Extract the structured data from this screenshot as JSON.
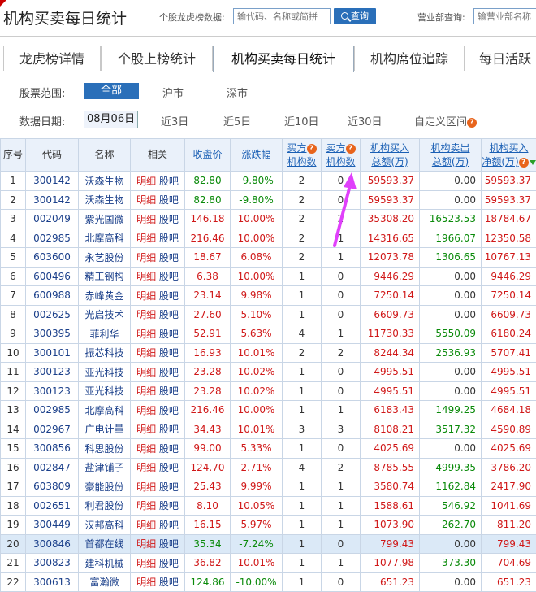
{
  "header": {
    "title": "机构买卖每日统计",
    "stock_search_label": "个股龙虎榜数据:",
    "stock_search_placeholder": "输代码、名称或简拼",
    "search_button": "查询",
    "branch_search_label": "营业部查询:",
    "branch_search_placeholder": "输营业部名称"
  },
  "tabs": [
    "龙虎榜详情",
    "个股上榜统计",
    "机构买卖每日统计",
    "机构席位追踪",
    "每日活跃"
  ],
  "active_tab": 2,
  "filters": {
    "range_label": "股票范围:",
    "range_options": [
      "全部",
      "沪市",
      "深市"
    ],
    "range_selected": "全部",
    "date_label": "数据日期:",
    "date_selected": "08月06日",
    "date_options": [
      "近3日",
      "近5日",
      "近10日",
      "近30日",
      "自定义区间"
    ]
  },
  "table": {
    "columns": [
      "序号",
      "代码",
      "名称",
      "相关",
      "收盘价",
      "涨跌幅",
      "买方机构数",
      "卖方机构数",
      "机构买入总额(万)",
      "机构卖出总额(万)",
      "机构买入净额(万)"
    ],
    "header_lines": {
      "buyers": [
        "买方",
        "机构数"
      ],
      "sellers": [
        "卖方",
        "机构数"
      ],
      "buy_total": [
        "机构买入",
        "总额(万)"
      ],
      "sell_total": [
        "机构卖出",
        "总额(万)"
      ],
      "net_buy": [
        "机构买入",
        "净额(万)"
      ]
    },
    "link_detail": "明细",
    "link_forum": "股吧",
    "rows": [
      {
        "no": "1",
        "code": "300142",
        "name": "沃森生物",
        "price": "82.80",
        "chg": "-9.80%",
        "buyers": "2",
        "sellers": "0",
        "buy": "59593.37",
        "sell": "0.00",
        "net": "59593.37"
      },
      {
        "no": "2",
        "code": "300142",
        "name": "沃森生物",
        "price": "82.80",
        "chg": "-9.80%",
        "buyers": "2",
        "sellers": "0",
        "buy": "59593.37",
        "sell": "0.00",
        "net": "59593.37"
      },
      {
        "no": "3",
        "code": "002049",
        "name": "紫光国微",
        "price": "146.18",
        "chg": "10.00%",
        "buyers": "2",
        "sellers": "2",
        "buy": "35308.20",
        "sell": "16523.53",
        "net": "18784.67"
      },
      {
        "no": "4",
        "code": "002985",
        "name": "北摩高科",
        "price": "216.46",
        "chg": "10.00%",
        "buyers": "2",
        "sellers": "1",
        "buy": "14316.65",
        "sell": "1966.07",
        "net": "12350.58"
      },
      {
        "no": "5",
        "code": "603600",
        "name": "永艺股份",
        "price": "18.67",
        "chg": "6.08%",
        "buyers": "2",
        "sellers": "1",
        "buy": "12073.78",
        "sell": "1306.65",
        "net": "10767.13"
      },
      {
        "no": "6",
        "code": "600496",
        "name": "精工钢构",
        "price": "6.38",
        "chg": "10.00%",
        "buyers": "1",
        "sellers": "0",
        "buy": "9446.29",
        "sell": "0.00",
        "net": "9446.29"
      },
      {
        "no": "7",
        "code": "600988",
        "name": "赤峰黄金",
        "price": "23.14",
        "chg": "9.98%",
        "buyers": "1",
        "sellers": "0",
        "buy": "7250.14",
        "sell": "0.00",
        "net": "7250.14"
      },
      {
        "no": "8",
        "code": "002625",
        "name": "光启技术",
        "price": "27.60",
        "chg": "5.10%",
        "buyers": "1",
        "sellers": "0",
        "buy": "6609.73",
        "sell": "0.00",
        "net": "6609.73"
      },
      {
        "no": "9",
        "code": "300395",
        "name": "菲利华",
        "price": "52.91",
        "chg": "5.63%",
        "buyers": "4",
        "sellers": "1",
        "buy": "11730.33",
        "sell": "5550.09",
        "net": "6180.24"
      },
      {
        "no": "10",
        "code": "300101",
        "name": "振芯科技",
        "price": "16.93",
        "chg": "10.01%",
        "buyers": "2",
        "sellers": "2",
        "buy": "8244.34",
        "sell": "2536.93",
        "net": "5707.41"
      },
      {
        "no": "11",
        "code": "300123",
        "name": "亚光科技",
        "price": "23.28",
        "chg": "10.02%",
        "buyers": "1",
        "sellers": "0",
        "buy": "4995.51",
        "sell": "0.00",
        "net": "4995.51"
      },
      {
        "no": "12",
        "code": "300123",
        "name": "亚光科技",
        "price": "23.28",
        "chg": "10.02%",
        "buyers": "1",
        "sellers": "0",
        "buy": "4995.51",
        "sell": "0.00",
        "net": "4995.51"
      },
      {
        "no": "13",
        "code": "002985",
        "name": "北摩高科",
        "price": "216.46",
        "chg": "10.00%",
        "buyers": "1",
        "sellers": "1",
        "buy": "6183.43",
        "sell": "1499.25",
        "net": "4684.18"
      },
      {
        "no": "14",
        "code": "002967",
        "name": "广电计量",
        "price": "34.43",
        "chg": "10.01%",
        "buyers": "3",
        "sellers": "3",
        "buy": "8108.21",
        "sell": "3517.32",
        "net": "4590.89"
      },
      {
        "no": "15",
        "code": "300856",
        "name": "科思股份",
        "price": "99.00",
        "chg": "5.33%",
        "buyers": "1",
        "sellers": "0",
        "buy": "4025.69",
        "sell": "0.00",
        "net": "4025.69"
      },
      {
        "no": "16",
        "code": "002847",
        "name": "盐津铺子",
        "price": "124.70",
        "chg": "2.71%",
        "buyers": "4",
        "sellers": "2",
        "buy": "8785.55",
        "sell": "4999.35",
        "net": "3786.20"
      },
      {
        "no": "17",
        "code": "603809",
        "name": "豪能股份",
        "price": "25.43",
        "chg": "9.99%",
        "buyers": "1",
        "sellers": "1",
        "buy": "3580.74",
        "sell": "1162.84",
        "net": "2417.90"
      },
      {
        "no": "18",
        "code": "002651",
        "name": "利君股份",
        "price": "8.10",
        "chg": "10.05%",
        "buyers": "1",
        "sellers": "1",
        "buy": "1588.61",
        "sell": "546.92",
        "net": "1041.69"
      },
      {
        "no": "19",
        "code": "300449",
        "name": "汉邦高科",
        "price": "16.15",
        "chg": "5.97%",
        "buyers": "1",
        "sellers": "1",
        "buy": "1073.90",
        "sell": "262.70",
        "net": "811.20"
      },
      {
        "no": "20",
        "code": "300846",
        "name": "首都在线",
        "price": "35.34",
        "chg": "-7.24%",
        "buyers": "1",
        "sellers": "0",
        "buy": "799.43",
        "sell": "0.00",
        "net": "799.43"
      },
      {
        "no": "21",
        "code": "300823",
        "name": "建科机械",
        "price": "36.82",
        "chg": "10.01%",
        "buyers": "1",
        "sellers": "1",
        "buy": "1077.98",
        "sell": "373.30",
        "net": "704.69"
      },
      {
        "no": "22",
        "code": "300613",
        "name": "富瀚微",
        "price": "124.86",
        "chg": "-10.00%",
        "buyers": "1",
        "sellers": "0",
        "buy": "651.23",
        "sell": "0.00",
        "net": "651.23"
      }
    ],
    "highlighted_row": 20
  },
  "colors": {
    "accent": "#2a6fb9",
    "up": "#d01818",
    "down": "#0a8a0a",
    "header_bg": "#eaf1fa",
    "annotation": "#e040fb"
  }
}
